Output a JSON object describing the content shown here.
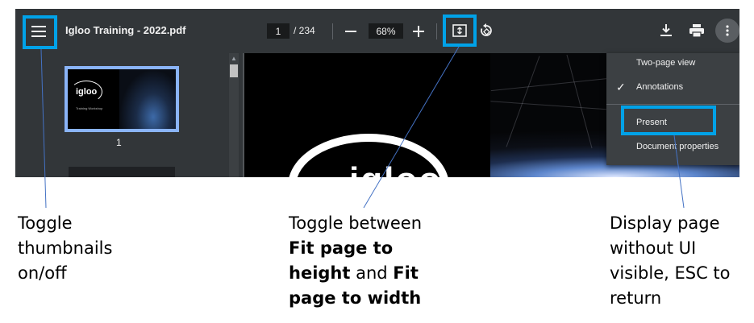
{
  "toolbar": {
    "title": "Igloo Training - 2022.pdf",
    "page_current": "1",
    "page_total": "/ 234",
    "zoom": "68%",
    "zoom_out_glyph": "—",
    "zoom_in_glyph": "+"
  },
  "icons": {
    "menu": "hamburger-menu-icon",
    "fit": "fit-page-icon",
    "rotate": "rotate-icon",
    "download": "download-icon",
    "print": "print-icon",
    "more": "more-vertical-icon",
    "check": "checkmark-icon"
  },
  "sidebar": {
    "thumbnails": [
      {
        "label": "1",
        "logo_text": "igloo",
        "caption": "Training Workshop"
      }
    ]
  },
  "page": {
    "logo_text": "igloo"
  },
  "menu": {
    "items": [
      {
        "label": "Two-page view",
        "checked": false
      },
      {
        "label": "Annotations",
        "checked": true
      },
      {
        "label": "Present",
        "checked": false
      },
      {
        "label": "Document properties",
        "checked": false
      }
    ]
  },
  "annotations": {
    "thumbnails": {
      "lines": [
        "Toggle",
        "thumbnails",
        "on/off"
      ]
    },
    "fit": {
      "line1": "Toggle between",
      "bold1": "Fit page to",
      "line3_bold": "height",
      "line3_rest": " and ",
      "line3_bold2": "Fit",
      "bold4": "page to width"
    },
    "present": {
      "lines": [
        "Display page",
        "without UI",
        "visible, ESC to",
        "return"
      ]
    }
  },
  "colors": {
    "toolbar_bg": "#323639",
    "highlight": "#00a2e8",
    "thumb_border": "#8ab4f8",
    "menu_bg": "#3c4043"
  }
}
